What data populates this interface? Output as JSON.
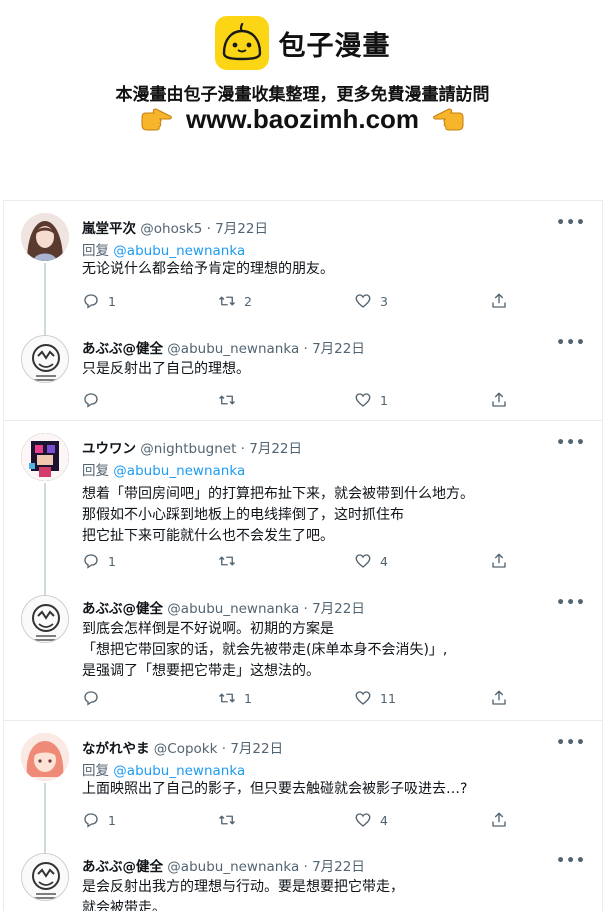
{
  "banner": {
    "site_name": "包子漫畫",
    "slogan": "本漫畫由包子漫畫收集整理，更多免費漫畫請訪問",
    "url": "www.baozimh.com"
  },
  "tweets": [
    {
      "name": "嵐堂平次",
      "meta": "@ohosk5 · 7月22日",
      "reply_prefix": "回复 ",
      "reply_handle": "@abubu_newnanka",
      "body": "无论说什么都会给予肯定的理想的朋友。",
      "replies": "1",
      "retweets": "2",
      "likes": "3"
    },
    {
      "name": "あぶぶ@健全",
      "meta": "@abubu_newnanka · 7月22日",
      "body": "只是反射出了自己的理想。",
      "replies": "",
      "retweets": "",
      "likes": "1"
    },
    {
      "name": "ユウワン",
      "meta": "@nightbugnet · 7月22日",
      "reply_prefix": "回复 ",
      "reply_handle": "@abubu_newnanka",
      "body": "想着「带回房间吧」的打算把布扯下来，就会被带到什么地方。\n那假如不小心踩到地板上的电线摔倒了，这时抓住布\n把它扯下来可能就什么也不会发生了吧。",
      "replies": "1",
      "retweets": "",
      "likes": "4"
    },
    {
      "name": "あぶぶ@健全",
      "meta": "@abubu_newnanka · 7月22日",
      "body": "到底会怎样倒是不好说啊。初期的方案是\n「想把它带回家的话，就会先被带走(床单本身不会消失)」,\n是强调了「想要把它带走」这想法的。",
      "replies": "",
      "retweets": "1",
      "likes": "11"
    },
    {
      "name": "ながれやま",
      "meta": "@Copokk · 7月22日",
      "reply_prefix": "回复 ",
      "reply_handle": "@abubu_newnanka",
      "body": "上面映照出了自己的影子，但只要去触碰就会被影子吸进去…?",
      "replies": "1",
      "retweets": "",
      "likes": "4"
    },
    {
      "name": "あぶぶ@健全",
      "meta": "@abubu_newnanka · 7月22日",
      "body": "是会反射出我方的理想与行动。要是想要把它带走，\n就会被带走。",
      "replies": "",
      "retweets": "",
      "likes": ""
    }
  ],
  "icons": {
    "more": "more-horizontal-icon",
    "reply": "reply-icon",
    "retweet": "retweet-icon",
    "like": "heart-icon",
    "share": "share-icon"
  },
  "colors": {
    "logo_yellow": "#fcd615",
    "link_blue": "#1d9bf0",
    "muted_gray": "#536471",
    "border": "#e6ecf0"
  }
}
